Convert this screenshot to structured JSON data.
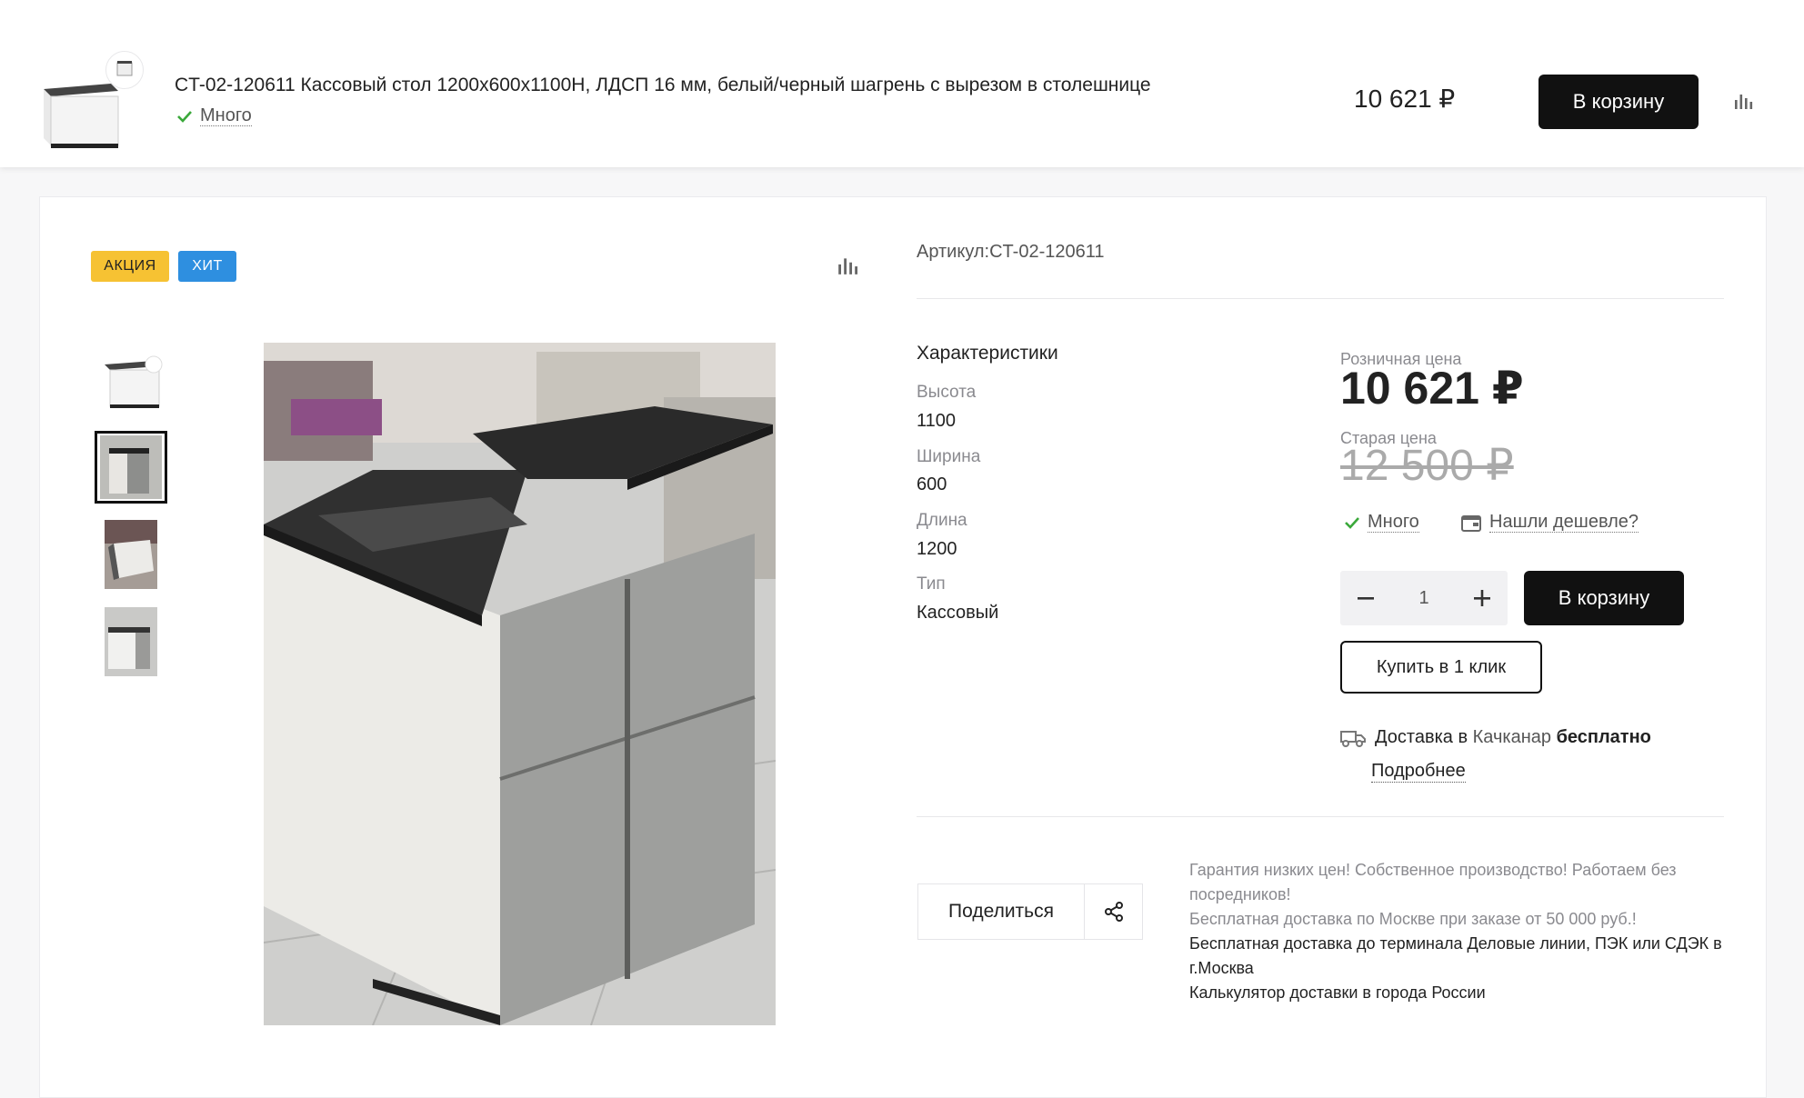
{
  "sticky": {
    "title": "CT-02-120611 Кассовый стол 1200х600х1100Н, ЛДСП 16 мм, белый/черный шагрень с вырезом в столешнице",
    "stock": "Много",
    "price": "10 621 ₽",
    "cart_button": "В корзину",
    "compare_icon": "compare-bars-icon"
  },
  "badges": {
    "sale": "АКЦИЯ",
    "hit": "ХИТ"
  },
  "gallery": {
    "compare_icon": "compare-bars-icon",
    "thumbnail_count": 4,
    "active_thumbnail": 2
  },
  "article": "Артикул:CT-02-120611",
  "specs": {
    "title": "Характеристики",
    "items": [
      {
        "label": "Высота",
        "value": "1100"
      },
      {
        "label": "Ширина",
        "value": "600"
      },
      {
        "label": "Длина",
        "value": "1200"
      },
      {
        "label": "Тип",
        "value": "Кассовый"
      }
    ]
  },
  "pricing": {
    "retail_label": "Розничная цена",
    "retail_price": "10 621 ₽",
    "old_label": "Старая цена",
    "old_price": "12 500 ₽",
    "stock": "Много",
    "cheaper_link": "Нашли дешевле?"
  },
  "quantity": {
    "value": "1"
  },
  "buttons": {
    "cart": "В корзину",
    "one_click": "Купить в 1 клик"
  },
  "delivery": {
    "prefix": "Доставка в",
    "city": "Качканар",
    "free": "бесплатно",
    "more": "Подробнее"
  },
  "share": {
    "label": "Поделиться"
  },
  "notes": {
    "line1": "Гарантия низких цен! Собственное производство! Работаем без посредников!",
    "line2": "Бесплатная доставка по Москве при заказе от 50 000 руб.!",
    "line3": "Бесплатная доставка до терминала Деловые линии, ПЭК или СДЭК в г.Москва",
    "line4": "Калькулятор доставки в города России"
  },
  "colors": {
    "accent": "#111111",
    "sale_badge": "#f6c233",
    "hit_badge": "#2e8fe0",
    "stock_check": "#3aa83a"
  }
}
